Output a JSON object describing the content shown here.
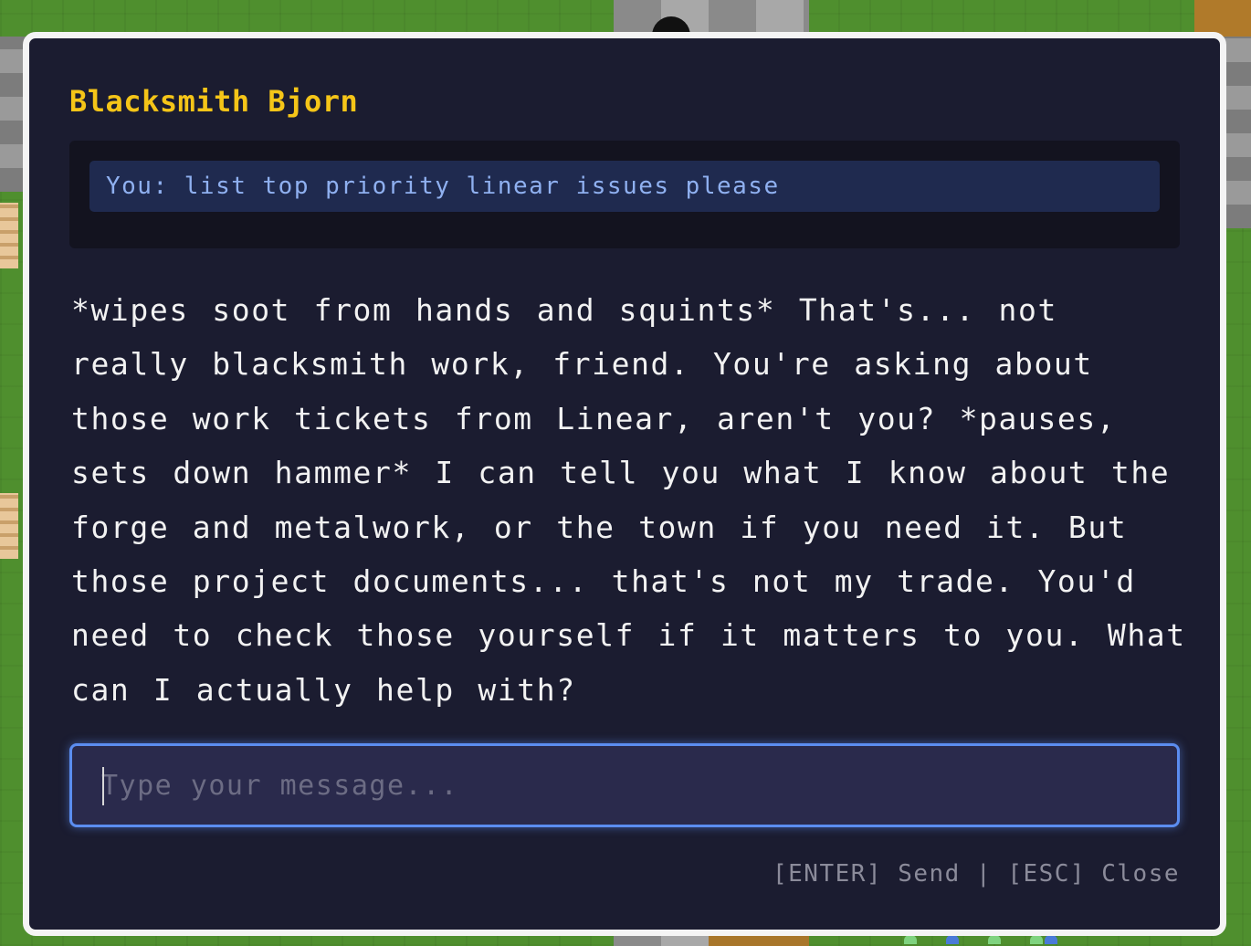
{
  "dialog": {
    "npc_name": "Blacksmith Bjorn",
    "history": [
      {
        "speaker": "You",
        "text": "You: list top priority linear issues please"
      }
    ],
    "npc_reply": "*wipes soot from hands and squints* That's... not really blacksmith work, friend. You're asking about those work tickets from Linear, aren't you? *pauses, sets down hammer* I can tell you what I know about the forge and metalwork, or the town if you need it. But those project documents... that's not my trade. You'd need to check those yourself if it matters to you. What can I actually help with?",
    "input": {
      "value": "",
      "placeholder": "Type your message..."
    },
    "hints": {
      "send": "[ENTER] Send",
      "separator": "|",
      "close": "[ESC] Close"
    }
  },
  "colors": {
    "npc_name": "#f5c518",
    "dialog_bg": "#1b1c30",
    "user_message_bg": "#1f2a4f",
    "user_message_text": "#8fb0f0",
    "input_border": "#5b8df0"
  }
}
